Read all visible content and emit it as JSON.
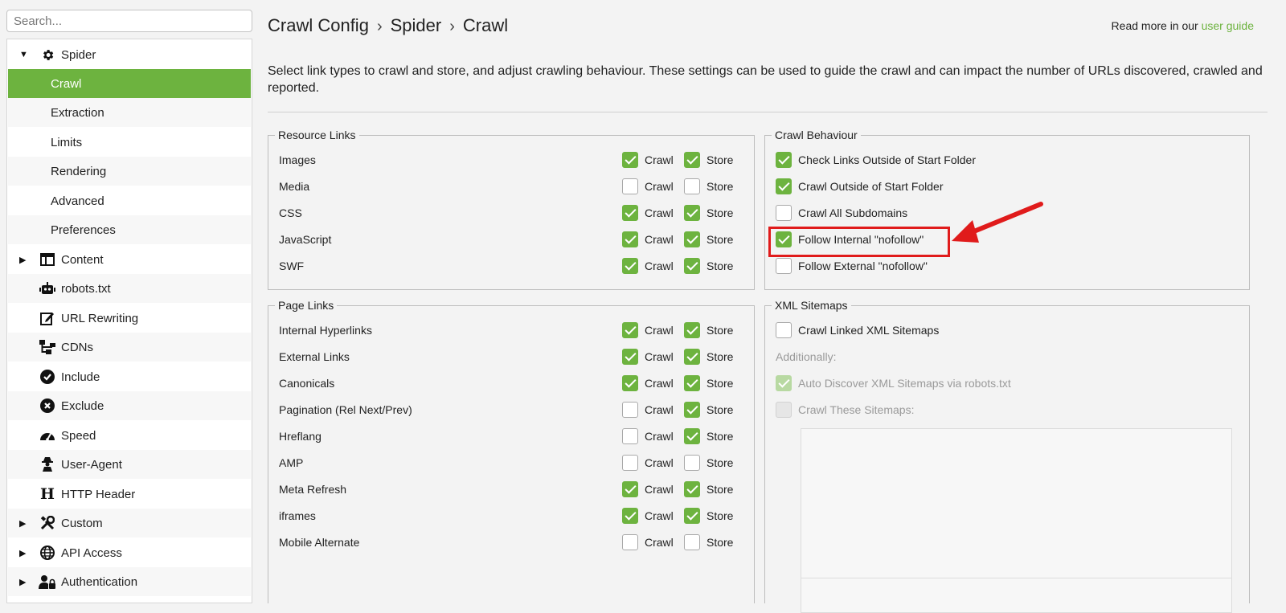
{
  "search": {
    "placeholder": "Search..."
  },
  "sidebar": {
    "items": [
      {
        "label": "Spider",
        "icon": "gear-icon",
        "expanded": true
      },
      {
        "label": "Crawl",
        "selected": true
      },
      {
        "label": "Extraction"
      },
      {
        "label": "Limits"
      },
      {
        "label": "Rendering"
      },
      {
        "label": "Advanced"
      },
      {
        "label": "Preferences"
      },
      {
        "label": "Content",
        "icon": "layout-icon",
        "collapsed": true
      },
      {
        "label": "robots.txt",
        "icon": "robot-icon"
      },
      {
        "label": "URL Rewriting",
        "icon": "edit-icon"
      },
      {
        "label": "CDNs",
        "icon": "network-icon"
      },
      {
        "label": "Include",
        "icon": "check-circle-icon"
      },
      {
        "label": "Exclude",
        "icon": "x-circle-icon"
      },
      {
        "label": "Speed",
        "icon": "speedometer-icon"
      },
      {
        "label": "User-Agent",
        "icon": "user-secret-icon"
      },
      {
        "label": "HTTP Header",
        "icon": "h-icon"
      },
      {
        "label": "Custom",
        "icon": "tools-icon",
        "collapsed": true
      },
      {
        "label": "API Access",
        "icon": "globe-icon",
        "collapsed": true
      },
      {
        "label": "Authentication",
        "icon": "user-lock-icon",
        "collapsed": true
      }
    ]
  },
  "header": {
    "breadcrumb": [
      "Crawl Config",
      "Spider",
      "Crawl"
    ],
    "separator": "›",
    "readmore_prefix": "Read more in our ",
    "readmore_link": "user guide"
  },
  "description": "Select link types to crawl and store, and adjust crawling behaviour. These settings can be used to guide the crawl and can impact the number of URLs discovered, crawled and reported.",
  "labels": {
    "crawl": "Crawl",
    "store": "Store"
  },
  "resource_links": {
    "title": "Resource Links",
    "rows": [
      {
        "label": "Images",
        "crawl": true,
        "store": true
      },
      {
        "label": "Media",
        "crawl": false,
        "store": false
      },
      {
        "label": "CSS",
        "crawl": true,
        "store": true
      },
      {
        "label": "JavaScript",
        "crawl": true,
        "store": true
      },
      {
        "label": "SWF",
        "crawl": true,
        "store": true
      }
    ]
  },
  "page_links": {
    "title": "Page Links",
    "rows": [
      {
        "label": "Internal Hyperlinks",
        "crawl": true,
        "store": true
      },
      {
        "label": "External Links",
        "crawl": true,
        "store": true
      },
      {
        "label": "Canonicals",
        "crawl": true,
        "store": true
      },
      {
        "label": "Pagination (Rel Next/Prev)",
        "crawl": false,
        "store": true
      },
      {
        "label": "Hreflang",
        "crawl": false,
        "store": true
      },
      {
        "label": "AMP",
        "crawl": false,
        "store": false
      },
      {
        "label": "Meta Refresh",
        "crawl": true,
        "store": true
      },
      {
        "label": "iframes",
        "crawl": true,
        "store": true
      },
      {
        "label": "Mobile Alternate",
        "crawl": false,
        "store": false
      }
    ]
  },
  "crawl_behaviour": {
    "title": "Crawl Behaviour",
    "options": [
      {
        "label": "Check Links Outside of Start Folder",
        "checked": true
      },
      {
        "label": "Crawl Outside of Start Folder",
        "checked": true
      },
      {
        "label": "Crawl All Subdomains",
        "checked": false
      },
      {
        "label": "Follow Internal \"nofollow\"",
        "checked": true,
        "highlighted": true
      },
      {
        "label": "Follow External \"nofollow\"",
        "checked": false
      }
    ]
  },
  "xml_sitemaps": {
    "title": "XML Sitemaps",
    "crawl_linked": {
      "label": "Crawl Linked XML Sitemaps",
      "checked": false
    },
    "additionally": "Additionally:",
    "auto_discover": {
      "label": "Auto Discover XML Sitemaps via robots.txt",
      "checked": true,
      "disabled": true
    },
    "crawl_these": {
      "label": "Crawl These Sitemaps:",
      "checked": false,
      "disabled": true
    }
  },
  "colors": {
    "accent": "#6db33f",
    "annotation": "#e01b1b"
  }
}
